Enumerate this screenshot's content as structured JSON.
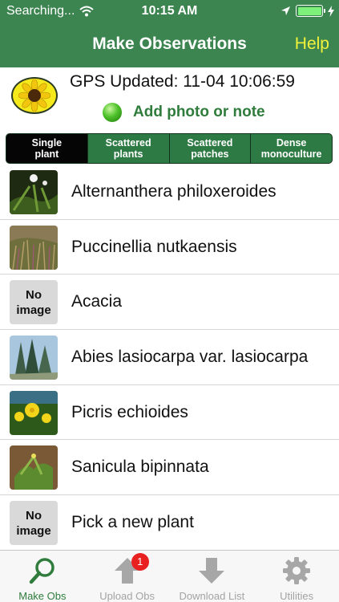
{
  "status": {
    "carrier": "Searching...",
    "time": "10:15 AM"
  },
  "nav": {
    "title": "Make Observations",
    "help": "Help"
  },
  "info": {
    "gps": "GPS Updated: 11-04 10:06:59",
    "add": "Add photo or note"
  },
  "density": {
    "options": [
      {
        "label": "Single plant",
        "selected": true
      },
      {
        "label": "Scattered plants",
        "selected": false
      },
      {
        "label": "Scattered patches",
        "selected": false
      },
      {
        "label": "Dense monoculture",
        "selected": false
      }
    ]
  },
  "plants": [
    {
      "name": "Alternanthera philoxeroides",
      "thumb": "photo-alternanthera"
    },
    {
      "name": "Puccinellia nutkaensis",
      "thumb": "photo-grass"
    },
    {
      "name": "Acacia",
      "thumb": "no-image",
      "noimg": "No image"
    },
    {
      "name": "Abies lasiocarpa var. lasiocarpa",
      "thumb": "photo-trees"
    },
    {
      "name": "Picris echioides",
      "thumb": "photo-yellow-flower"
    },
    {
      "name": "Sanicula bipinnata",
      "thumb": "photo-sanicula"
    },
    {
      "name": "Pick a new plant",
      "thumb": "no-image",
      "noimg": "No image"
    }
  ],
  "tabs": [
    {
      "label": "Make Obs",
      "icon": "search-icon",
      "active": true
    },
    {
      "label": "Upload Obs",
      "icon": "upload-arrow-icon",
      "badge": "1"
    },
    {
      "label": "Download List",
      "icon": "download-arrow-icon"
    },
    {
      "label": "Utilities",
      "icon": "gear-icon"
    }
  ],
  "colors": {
    "header": "#3d8550",
    "help": "#f3f23a",
    "accent": "#2f7c3c",
    "badge": "#e8201f"
  }
}
